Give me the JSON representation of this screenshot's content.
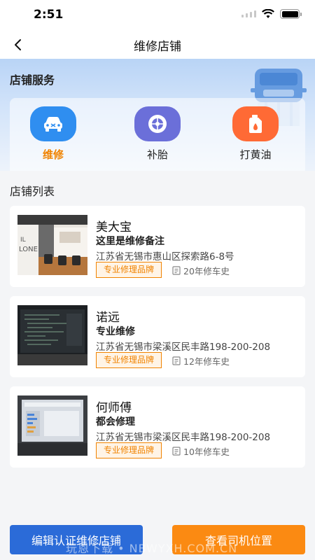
{
  "status_bar": {
    "time": "2:51"
  },
  "navbar": {
    "title": "维修店铺"
  },
  "services": {
    "title": "店铺服务",
    "items": [
      {
        "label": "维修",
        "icon": "car-repair-icon",
        "color": "#2f8ef0",
        "active": true
      },
      {
        "label": "补胎",
        "icon": "tire-icon",
        "color": "#6b6fd9",
        "active": false
      },
      {
        "label": "打黄油",
        "icon": "oil-can-icon",
        "color": "#ff6a35",
        "active": false
      }
    ]
  },
  "shop_list": {
    "title": "店铺列表",
    "shops": [
      {
        "name": "美大宝",
        "note": "这里是维修备注",
        "address": "江苏省无锡市惠山区探索路6-8号",
        "tag": "专业修理品牌",
        "history": "20年修车史"
      },
      {
        "name": "诺远",
        "note": "专业维修",
        "address": "江苏省无锡市梁溪区民丰路198-200-208",
        "tag": "专业修理品牌",
        "history": "12年修车史"
      },
      {
        "name": "何师傅",
        "note": "都会修理",
        "address": "江苏省无锡市梁溪区民丰路198-200-208",
        "tag": "专业修理品牌",
        "history": "10年修车史"
      }
    ]
  },
  "bottom": {
    "edit_label": "编辑认证维修店铺",
    "location_label": "查看司机位置"
  },
  "watermark": "玩恩下载 • NBWYXH.COM.CN",
  "colors": {
    "accent": "#f08300",
    "primary_button": "#2b6bd8",
    "secondary_button": "#fb8a12"
  }
}
